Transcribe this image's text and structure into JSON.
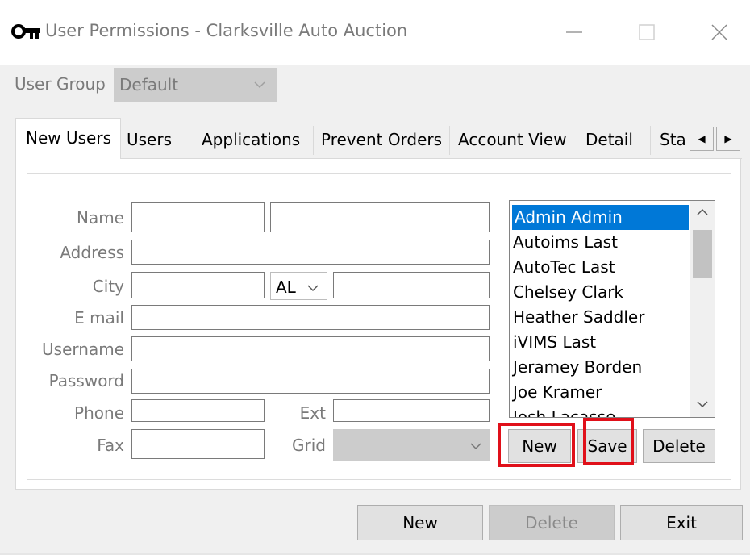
{
  "window": {
    "title": "User Permissions - Clarksville Auto Auction",
    "icon": "key-icon",
    "controls": [
      "minimize",
      "maximize",
      "close"
    ]
  },
  "user_group": {
    "label": "User Group",
    "value": "Default"
  },
  "tabs": [
    {
      "label": "New Users",
      "active": true
    },
    {
      "label": "Users",
      "active": false
    },
    {
      "label": "Applications",
      "active": false
    },
    {
      "label": "Prevent Orders",
      "active": false
    },
    {
      "label": "Account View",
      "active": false
    },
    {
      "label": "Detail",
      "active": false
    },
    {
      "label": "Sta",
      "active": false
    }
  ],
  "tab_scroll": {
    "left": "◀",
    "right": "▶"
  },
  "form": {
    "name_label": "Name",
    "address_label": "Address",
    "city_label": "City",
    "state_value": "AL",
    "email_label": "E mail",
    "username_label": "Username",
    "password_label": "Password",
    "phone_label": "Phone",
    "ext_label": "Ext",
    "fax_label": "Fax",
    "grid_label": "Grid"
  },
  "users_list": {
    "items": [
      "Admin Admin",
      "Autoims Last",
      "AutoTec Last",
      "Chelsey Clark",
      "Heather Saddler",
      "iVIMS Last",
      "Jeramey Borden",
      "Joe Kramer",
      "Josh Lacasse"
    ],
    "selected_index": 0
  },
  "panel_buttons": {
    "new": "New",
    "save": "Save",
    "delete": "Delete"
  },
  "bottom_buttons": {
    "new": "New",
    "delete": "Delete",
    "exit": "Exit"
  },
  "colors": {
    "selection": "#0078d7",
    "highlight": "#e0101a",
    "disabled": "#cccccc"
  }
}
